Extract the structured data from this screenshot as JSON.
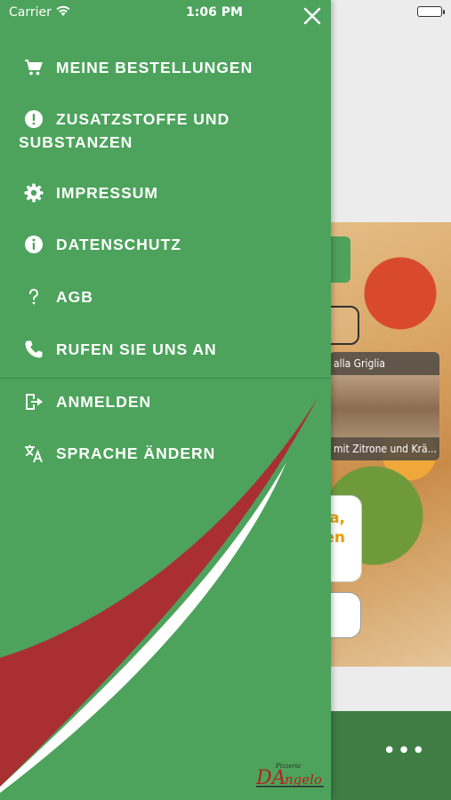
{
  "status": {
    "carrier": "Carrier",
    "time": "1:06 PM"
  },
  "drawer": {
    "items": [
      {
        "label": "MEINE BESTELLUNGEN",
        "icon": "cart-icon"
      },
      {
        "label_line1": "ZUSATZSTOFFE UND",
        "label_line2": "SUBSTANZEN",
        "icon": "alert-circle-icon"
      },
      {
        "label": "IMPRESSUM",
        "icon": "gear-icon"
      },
      {
        "label": "DATENSCHUTZ",
        "icon": "info-circle-icon"
      },
      {
        "label": "AGB",
        "icon": "question-icon"
      },
      {
        "label": "RUFEN SIE UNS AN",
        "icon": "phone-icon"
      },
      {
        "label": "ANMELDEN",
        "icon": "login-icon"
      },
      {
        "label": "SPRACHE ÄNDERN",
        "icon": "translate-icon"
      }
    ],
    "logo_text": "DAngelo",
    "logo_subtext": "Pizzeria"
  },
  "background": {
    "card_title": "alla Griglia",
    "card_subtitle": "mit Zitrone und Krä...",
    "promo_text": "a,\nen",
    "more_label": "•••"
  },
  "colors": {
    "drawer_green": "#4da35c",
    "bottom_bar_green": "#3f7d45",
    "swoosh_red": "#a92f33",
    "swoosh_white": "#ffffff",
    "promo_orange": "#e69c00"
  }
}
